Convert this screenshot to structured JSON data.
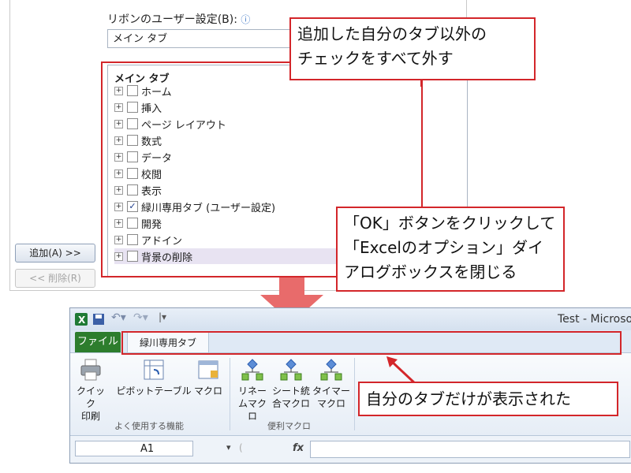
{
  "dialog": {
    "customize_label": "リボンのユーザー設定(B):",
    "info_icon": "info-icon",
    "combo_value": "メイン タブ",
    "tree_header": "メイン タブ",
    "tree_items": [
      {
        "label": "ホーム",
        "checked": false
      },
      {
        "label": "挿入",
        "checked": false
      },
      {
        "label": "ページ レイアウト",
        "checked": false
      },
      {
        "label": "数式",
        "checked": false
      },
      {
        "label": "データ",
        "checked": false
      },
      {
        "label": "校閲",
        "checked": false
      },
      {
        "label": "表示",
        "checked": false
      },
      {
        "label": "緑川専用タブ (ユーザー設定)",
        "checked": true
      },
      {
        "label": "開発",
        "checked": false
      },
      {
        "label": "アドイン",
        "checked": false
      },
      {
        "label": "背景の削除",
        "checked": false
      }
    ],
    "add_button": "追加(A) >>",
    "remove_button": "<< 削除(R)"
  },
  "callouts": {
    "uncheck": [
      "追加した自分のタブ以外の",
      "チェックをすべて外す"
    ],
    "ok": [
      "「OK」ボタンをクリックして",
      "「Excelのオプション」ダイ",
      "アログボックスを閉じる"
    ],
    "result": "自分のタブだけが表示された"
  },
  "excel": {
    "title": "Test - Microsof",
    "file_tab": "ファイル",
    "custom_tab": "緑川専用タブ",
    "buttons": [
      {
        "line1": "クイック",
        "line2": "印刷",
        "icon": "printer-icon"
      },
      {
        "line1": "ピボットテーブル",
        "line2": "",
        "icon": "pivot-table-icon"
      },
      {
        "line1": "マクロ",
        "line2": "",
        "icon": "macro-icon"
      },
      {
        "line1": "リネー",
        "line2": "ムマクロ",
        "icon": "flowchart-icon"
      },
      {
        "line1": "シート統",
        "line2": "合マクロ",
        "icon": "flowchart-icon"
      },
      {
        "line1": "タイマー",
        "line2": "マクロ",
        "icon": "flowchart-icon"
      }
    ],
    "groups": [
      "よく使用する機能",
      "便利マクロ"
    ],
    "name_box": "A1",
    "fx": "fx"
  },
  "colors": {
    "accent_red": "#d3262a",
    "file_tab_green": "#2d7d2d"
  }
}
